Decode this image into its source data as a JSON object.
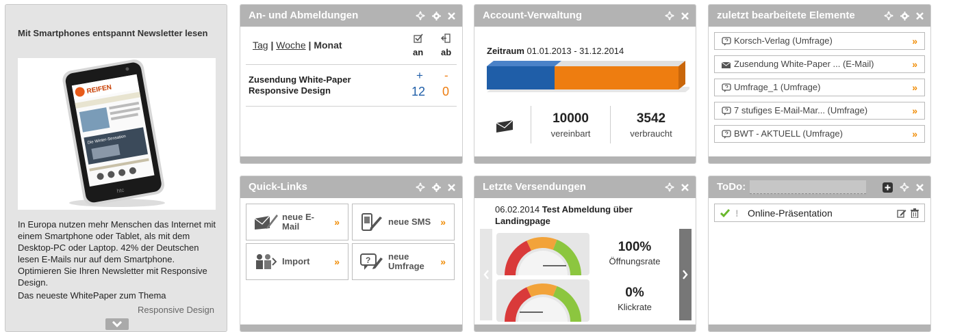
{
  "promo": {
    "title": "Mit Smartphones entspannt Newsletter lesen",
    "phone_brand": "REIFEN",
    "phone_text_1": "Die Winter-Sensation",
    "phone_maker": "htc",
    "body": "In Europa nutzen mehr Menschen das Internet mit einem Smartphone oder Tablet, als mit dem Desktop-PC oder Laptop. 42% der Deutschen lesen E-Mails nur auf dem Smartphone. Optimieren Sie Ihren Newsletter mit Responsive Design.",
    "body2": "Das neueste WhitePaper zum Thema",
    "body3": "Responsive Design"
  },
  "anab": {
    "title": "An- und Abmeldungen",
    "tag": "Tag",
    "sep1": " | ",
    "woche": "Woche",
    "sep2": " | ",
    "monat": "Monat",
    "col_an": "an",
    "col_ab": "ab",
    "row_label": "Zusendung White-Paper Responsive Design",
    "plus": "+",
    "minus": "-",
    "an_value": "12",
    "ab_value": "0"
  },
  "account": {
    "title": "Account-Verwaltung",
    "zeitraum_label": "Zeitraum",
    "zeitraum_value": " 01.01.2013 - 31.12.2014",
    "used_fraction": 0.3542,
    "agreed": "10000",
    "agreed_label": "vereinbart",
    "used": "3542",
    "used_label": "verbraucht"
  },
  "recent": {
    "title": "zuletzt bearbeitete Elemente",
    "items": [
      {
        "label": "Korsch-Verlag (Umfrage)",
        "icon": "survey-icon"
      },
      {
        "label": "Zusendung White-Paper ... (E-Mail)",
        "icon": "mail-icon"
      },
      {
        "label": "Umfrage_1 (Umfrage)",
        "icon": "survey-icon"
      },
      {
        "label": "7 stufiges E-Mail-Mar... (Umfrage)",
        "icon": "survey-icon"
      },
      {
        "label": "BWT - AKTUELL (Umfrage)",
        "icon": "survey-icon"
      }
    ],
    "arrow": "»"
  },
  "quick": {
    "title": "Quick-Links",
    "email": "neue E-Mail",
    "sms": "neue SMS",
    "import": "Import",
    "survey": "neue Umfrage",
    "arrow": "»"
  },
  "sends": {
    "title": "Letzte Versendungen",
    "date": "06.02.2014",
    "name": "Test Abmeldung über Landingpage",
    "open_value": "100%",
    "open_label": "Öffnungsrate",
    "open_fraction": 1.0,
    "click_value": "0%",
    "click_label": "Klickrate",
    "click_fraction": 0.0
  },
  "todo": {
    "title": "ToDo:",
    "input_value": "",
    "items": [
      {
        "label": "Online-Präsentation",
        "mark": "!"
      }
    ]
  },
  "colors": {
    "blue": "#1f5ea8",
    "orange": "#ee7d10",
    "accent": "#f08a00",
    "header": "#b3b3b3"
  }
}
